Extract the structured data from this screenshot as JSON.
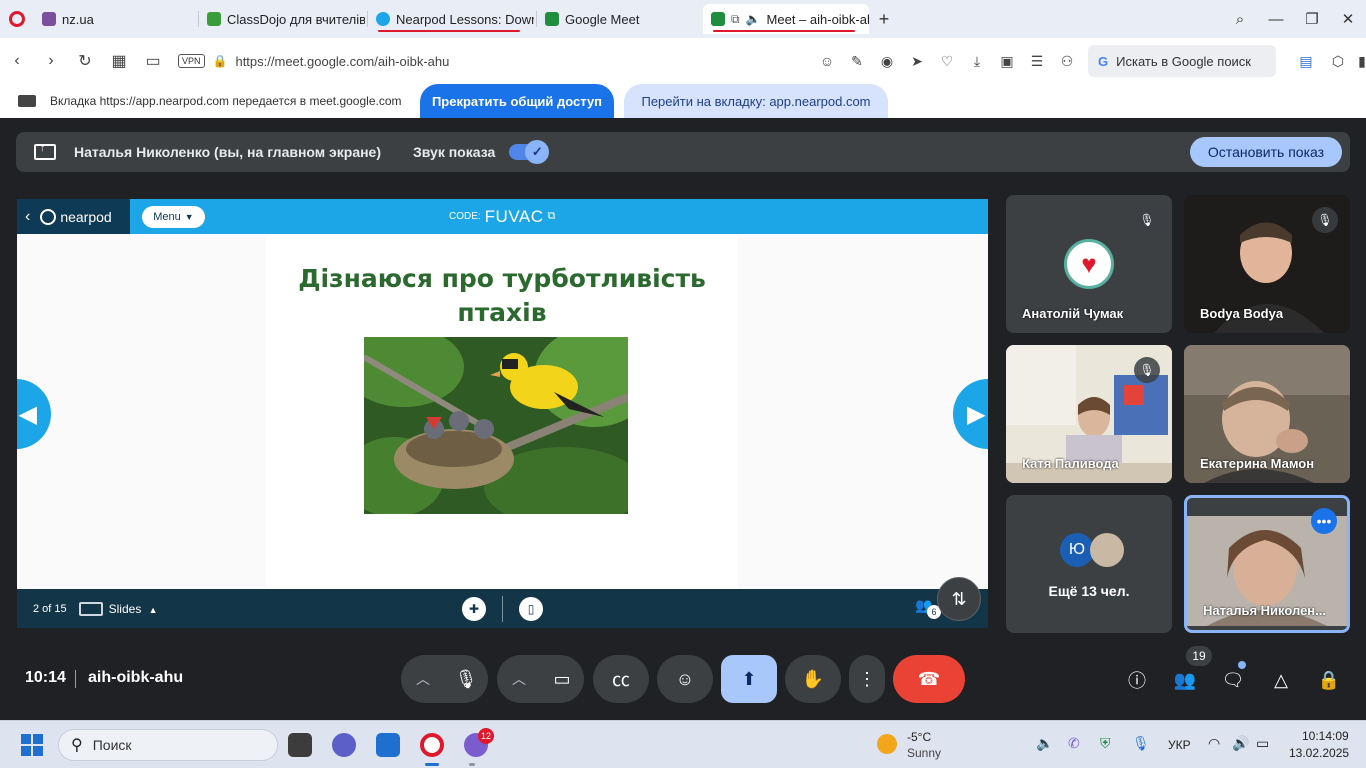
{
  "browser": {
    "tabs": [
      {
        "label": "nz.ua",
        "icon": "nzua-icon",
        "color": "#7b4f9e"
      },
      {
        "label": "ClassDojo для вчителів",
        "icon": "classdojo-icon",
        "color": "#3b9c3b"
      },
      {
        "label": "Nearpod Lessons: Downlo",
        "icon": "nearpod-icon",
        "color": "#1ca6e8"
      },
      {
        "label": "Google Meet",
        "icon": "meet-icon",
        "color": "#1e8e3e"
      },
      {
        "label": "Meet – aih-oibk-al",
        "icon": "meet-icon",
        "color": "#1e8e3e"
      }
    ],
    "url": "https://meet.google.com/aih-oibk-ahu",
    "vpn_label": "VPN",
    "search_placeholder": "Искать в Google поиск"
  },
  "share_infobar": {
    "message": "Вкладка https://app.nearpod.com передается в meet.google.com",
    "stop_sharing": "Прекратить общий доступ",
    "go_to_tab": "Перейти на вкладку: app.nearpod.com"
  },
  "presenting_bar": {
    "presenter": "Наталья Николенко (вы, на главном экране)",
    "sound_label": "Звук показа",
    "stop_button": "Остановить показ"
  },
  "nearpod": {
    "logo_text": "nearpod",
    "menu_label": "Menu",
    "code_label": "CODE:",
    "code_value": "FUVAC",
    "slide_title_line1": "Дізнаюся про турботливість",
    "slide_title_line2": "птахів",
    "page_indicator": "2 of 15",
    "slides_label": "Slides",
    "students_count": "6"
  },
  "participants": [
    {
      "name": "Анатолій Чумак",
      "muted": true
    },
    {
      "name": "Bodya Bodya",
      "muted": true
    },
    {
      "name": "Катя Паливода",
      "muted": true
    },
    {
      "name": "Екатерина Мамон",
      "muted": false
    },
    {
      "name": "Ещё 13 чел.",
      "avatar_letter": "Ю"
    },
    {
      "name": "Наталья Николен..."
    }
  ],
  "meet": {
    "time": "10:14",
    "meeting_code": "aih-oibk-ahu",
    "people_count": "19"
  },
  "taskbar": {
    "search_label": "Поиск",
    "viber_badge": "12",
    "weather_temp": "-5°C",
    "weather_desc": "Sunny",
    "language": "УКР",
    "time": "10:14:09",
    "date": "13.02.2025"
  },
  "colors": {
    "meet_bg": "#202124",
    "meet_accent": "#a8c7fa",
    "end_call": "#ea4335",
    "nearpod_blue": "#1ca6e8",
    "nearpod_dark": "#133548",
    "opera_red": "#e0182d"
  }
}
